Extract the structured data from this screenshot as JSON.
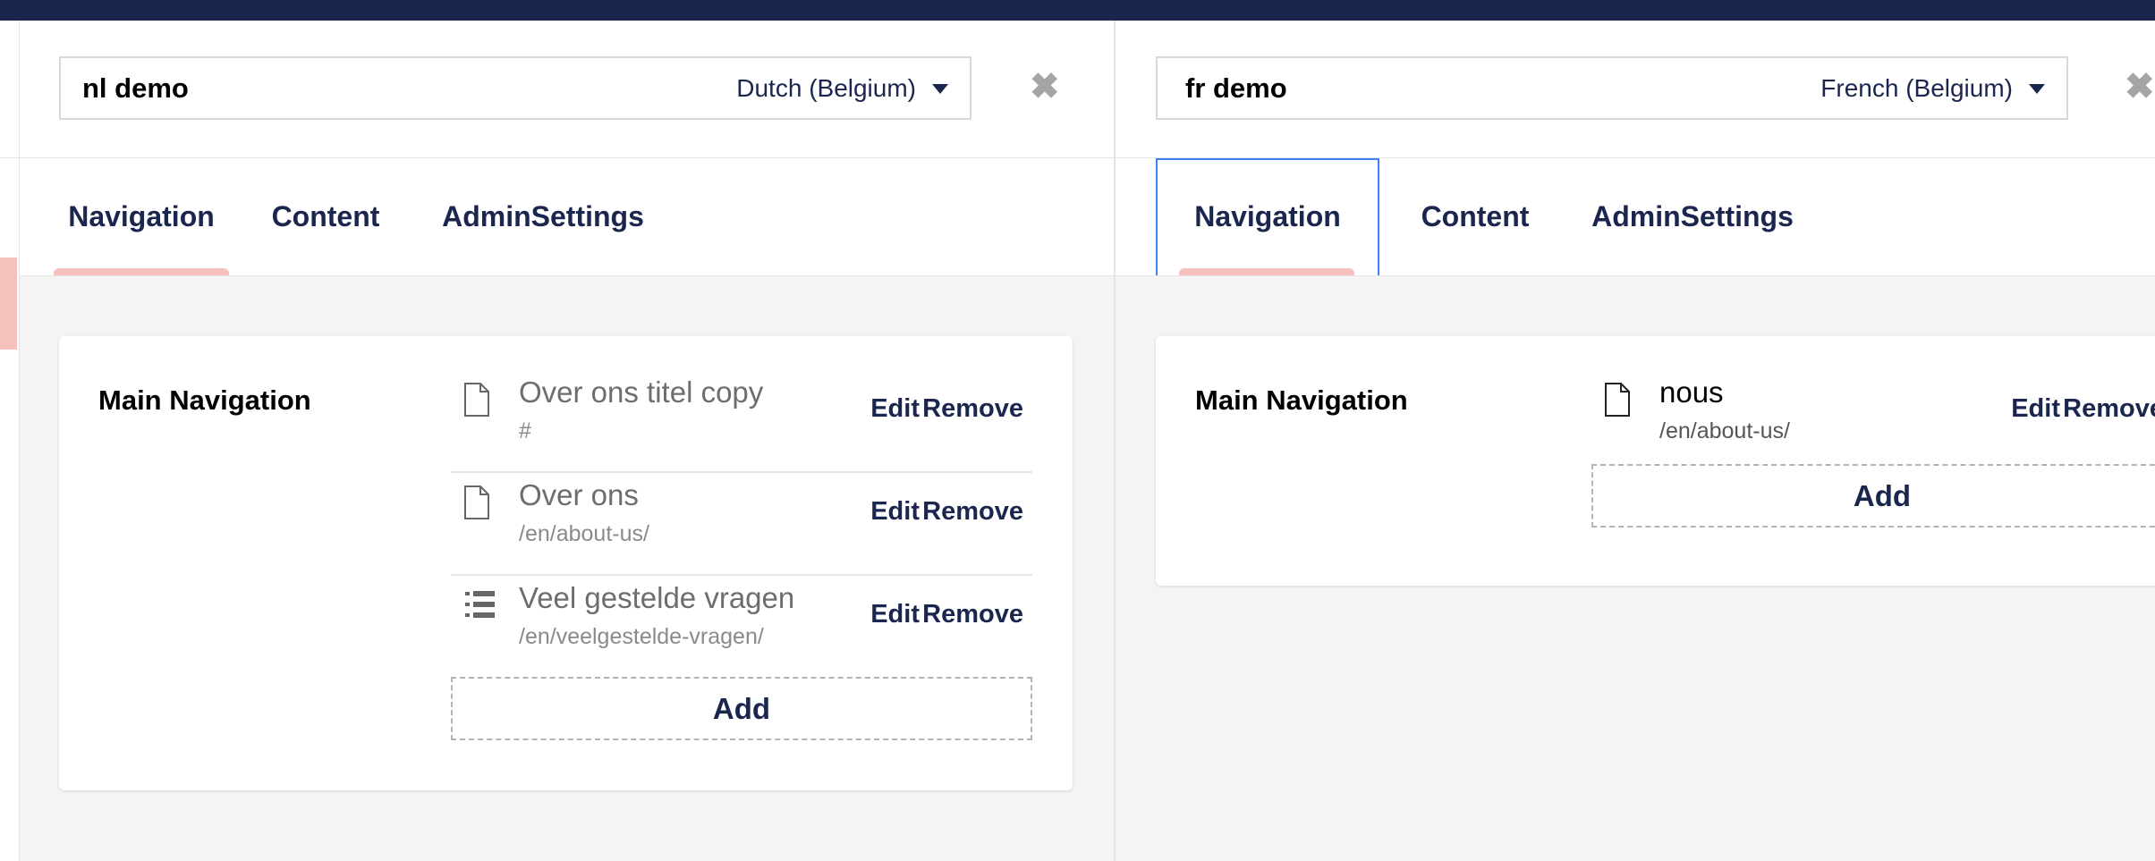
{
  "panes": [
    {
      "variant_name": "nl demo",
      "language": "Dutch (Belgium)",
      "tabs": [
        "Navigation",
        "Content",
        "AdminSettings"
      ],
      "active_tab": "Navigation",
      "section_title": "Main Navigation",
      "items": [
        {
          "title": "Over ons titel copy",
          "url": "#",
          "icon": "document-icon",
          "edit": "Edit",
          "remove": "Remove"
        },
        {
          "title": "Over ons",
          "url": "/en/about-us/",
          "icon": "document-icon",
          "edit": "Edit",
          "remove": "Remove"
        },
        {
          "title": "Veel gestelde vragen",
          "url": "/en/veelgestelde-vragen/",
          "icon": "numbered-list-icon",
          "edit": "Edit",
          "remove": "Remove"
        }
      ],
      "add_label": "Add"
    },
    {
      "variant_name": "fr demo",
      "language": "French (Belgium)",
      "tabs": [
        "Navigation",
        "Content",
        "AdminSettings"
      ],
      "active_tab": "Navigation",
      "section_title": "Main Navigation",
      "items": [
        {
          "title": "nous",
          "url": "/en/about-us/",
          "icon": "document-icon",
          "edit": "Edit",
          "remove": "Remove"
        }
      ],
      "add_label": "Add"
    }
  ],
  "colors": {
    "topbar": "#1b264f",
    "accent_text": "#1b264f",
    "tab_underline": "#f5c1bd",
    "focus_outline": "#3b82f6",
    "body_bg": "#f5f3f3"
  }
}
